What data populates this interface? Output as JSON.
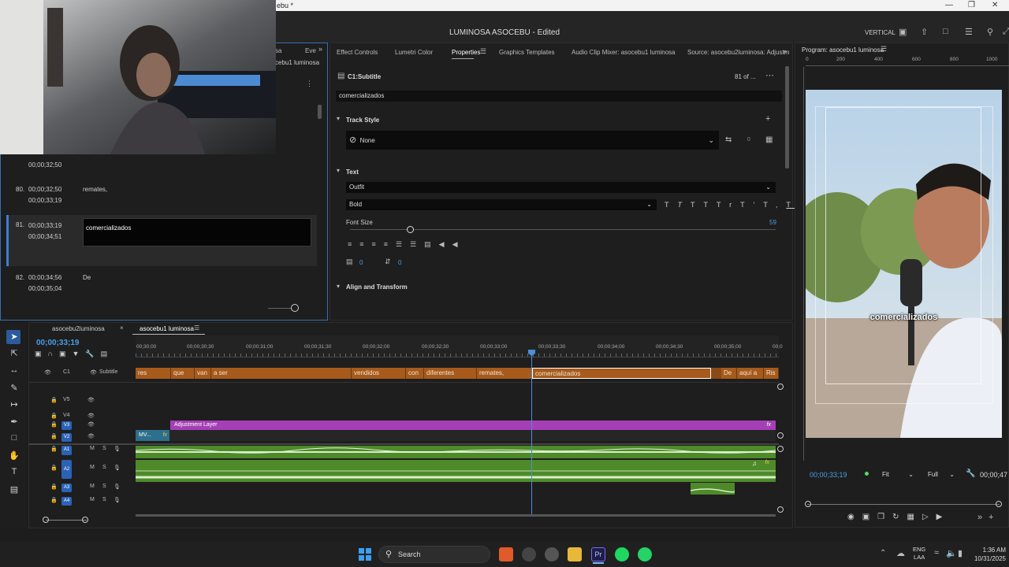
{
  "window": {
    "title": "ebu *",
    "app_title": "LUMINOSA ASOCEBU",
    "edited": "Edited",
    "layout_label": "VERTICAL"
  },
  "left_panel": {
    "tab_partial_a": "sa",
    "tab_partial_b": "Eve",
    "sequence_partial": "cebu1 luminosa",
    "captions": [
      {
        "num": "",
        "tc_in": "00;00;32;50",
        "tc_out": "",
        "text": ""
      },
      {
        "num": "80.",
        "tc_in": "00;00;32;50",
        "tc_out": "00;00;33;19",
        "text": "remates,"
      },
      {
        "num": "81.",
        "tc_in": "00;00;33;19",
        "tc_out": "00;00;34;51",
        "text": "comercializados"
      },
      {
        "num": "82.",
        "tc_in": "00;00;34;56",
        "tc_out": "00;00;35;04",
        "text": "De"
      }
    ]
  },
  "properties": {
    "tabs": [
      "Effect Controls",
      "Lumetri Color",
      "Properties",
      "Graphics Templates",
      "Audio Clip Mixer: asocebu1 luminosa",
      "Source: asocebu2luminosa: Adjustm"
    ],
    "active_tab": "Properties",
    "clip_name": "C1:Subtitle",
    "clip_count": "81 of ...",
    "caption_text": "comercializados",
    "track_style_header": "Track Style",
    "track_style_value": "None",
    "track_style_num": "0",
    "text_header": "Text",
    "font_family": "Outfit",
    "font_weight": "Bold",
    "font_size_label": "Font Size",
    "font_size": "59",
    "tracking_value": "0",
    "leading_value": "0",
    "align_header": "Align and Transform",
    "style_buttons": [
      "T",
      "T",
      "TT",
      "Tr",
      "T'",
      "T,",
      "T"
    ]
  },
  "program": {
    "title": "Program: asocebu1 luminosa",
    "ruler": [
      "0",
      "200",
      "400",
      "600",
      "800",
      "1000"
    ],
    "caption": "comercializados",
    "timecode": "00;00;33;19",
    "fit": "Fit",
    "quality": "Full",
    "duration": "00;00;47"
  },
  "timeline": {
    "tabs": [
      "asocebu2luminosa",
      "asocebu1 luminosa"
    ],
    "timecode": "00;00;33;19",
    "ruler": [
      "00;30;00",
      "00;00;30;30",
      "00;00;31;00",
      "00;00;31;30",
      "00;00;32;00",
      "00;00;32;30",
      "00;00;33;00",
      "00;00;33;30",
      "00;00;34;00",
      "00;00;34;30",
      "00;00;35;00",
      "00;0"
    ],
    "subtitle_track": {
      "badge": "C1",
      "label": "Subtitle"
    },
    "tracks": [
      "V5",
      "V4",
      "V3",
      "V2",
      "A1",
      "A2",
      "A3",
      "A4"
    ],
    "track_letters": {
      "mute": "M",
      "solo": "S"
    },
    "subtitle_clips": [
      "res",
      "que",
      "van",
      "a ser",
      "vendidos",
      "con",
      "diferentes",
      "remates,",
      "comercializados",
      "De",
      "aquí a",
      "Ris"
    ],
    "adjustment_layer": "Adjustment Layer",
    "mv_clip": "MV...",
    "fx": "fx"
  },
  "taskbar": {
    "search": "Search",
    "lang_top": "ENG",
    "lang_bottom": "LAA",
    "time": "1:36 AM",
    "date": "10/31/2025"
  },
  "colors": {
    "subtitle_clip": "#a65a1b",
    "adjustment_layer": "#a53fb6",
    "audio_clip": "#4e8a2a",
    "track_badge": "#2b62b6",
    "playhead": "#4a8fd8"
  }
}
